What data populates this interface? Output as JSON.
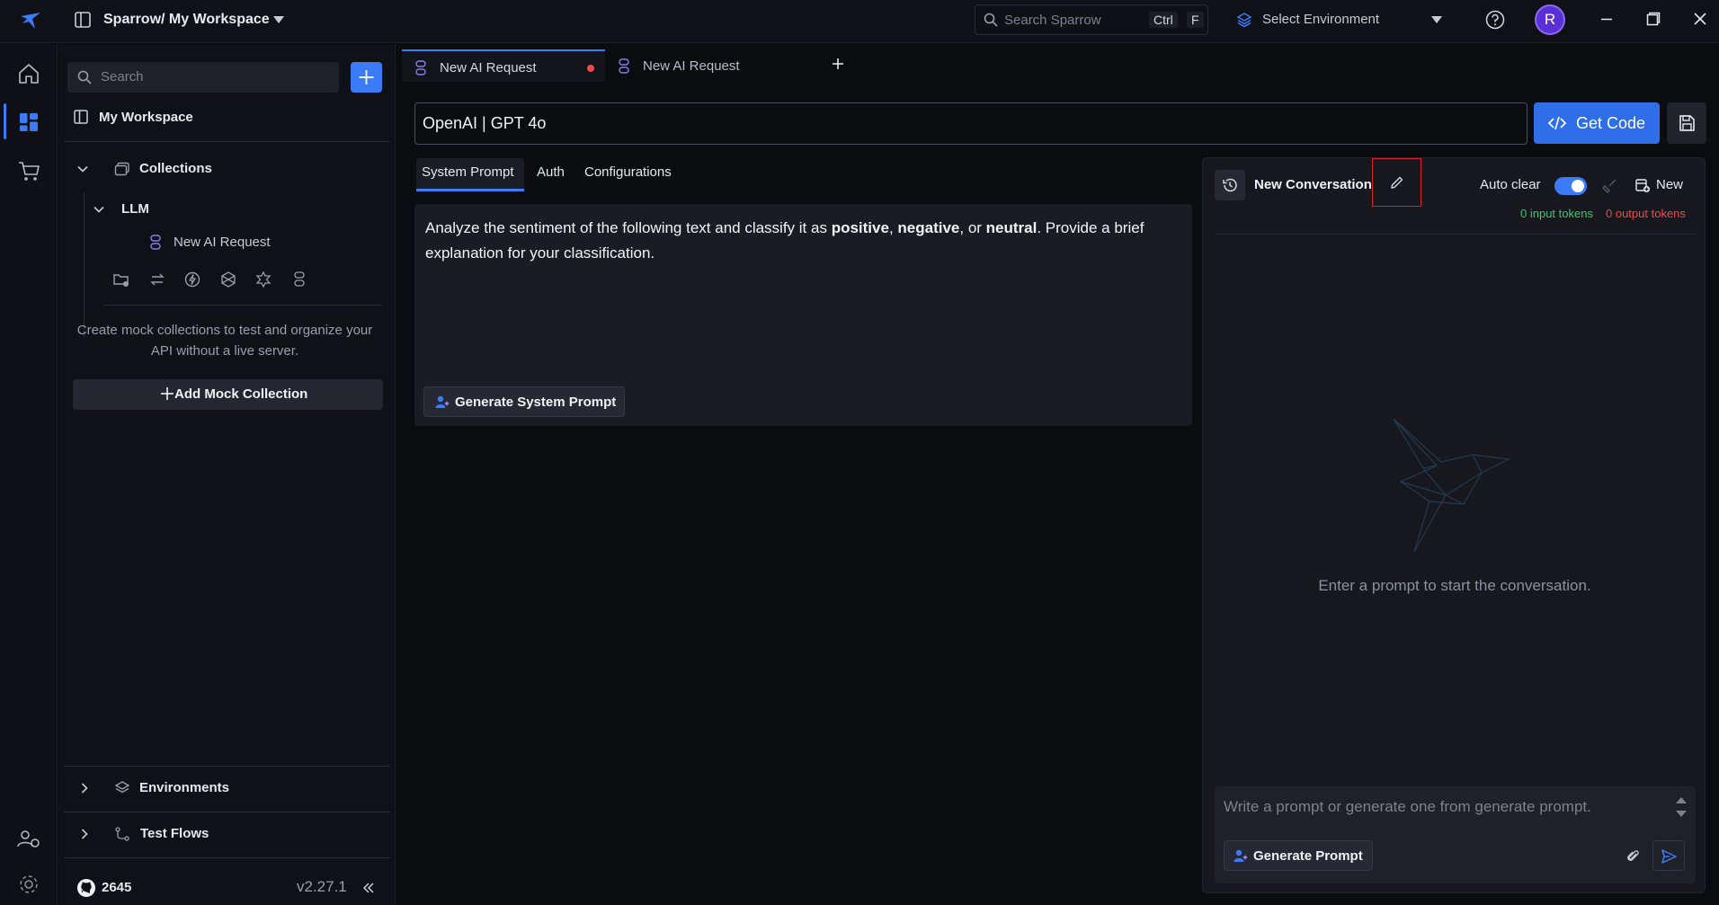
{
  "titlebar": {
    "workspace_title": "Sparrow/ My Workspace",
    "search_placeholder": "Search Sparrow",
    "shortcut_ctrl": "Ctrl",
    "shortcut_key": "F",
    "environment_label": "Select Environment",
    "avatar_initial": "R"
  },
  "sidebar": {
    "search_placeholder": "Search",
    "workspace_name": "My Workspace",
    "collections_label": "Collections",
    "folder_label": "LLM",
    "request_label": "New AI Request",
    "mock_text": "Create mock collections to test and organize your API without a live server.",
    "mock_button_label": "Add Mock Collection",
    "environments_label": "Environments",
    "test_flows_label": "Test Flows",
    "github_stars": "2645",
    "version": "v2.27.1"
  },
  "tabs": [
    {
      "label": "New AI Request",
      "unsaved": true,
      "active": true
    },
    {
      "label": "New AI Request",
      "unsaved": false,
      "active": false
    }
  ],
  "request": {
    "model": "OpenAI | GPT 4o",
    "get_code_label": "Get Code",
    "subtabs": [
      "System Prompt",
      "Auth",
      "Configurations"
    ],
    "prompt_part1": "Analyze the sentiment of the following text and classify it as ",
    "prompt_bold1": "positive",
    "prompt_sep1": ", ",
    "prompt_bold2": "negative",
    "prompt_sep2": ", or ",
    "prompt_bold3": "neutral",
    "prompt_part2": ". Provide a brief explanation for your classification.",
    "generate_system_prompt_label": "Generate System Prompt"
  },
  "chat": {
    "title": "New Conversation",
    "auto_clear_label": "Auto clear",
    "auto_clear_on": true,
    "new_label": "New",
    "input_tokens": "0 input tokens",
    "output_tokens": "0 output tokens",
    "empty_text": "Enter a prompt to start the conversation.",
    "input_placeholder": "Write a prompt or generate one from generate prompt.",
    "generate_prompt_label": "Generate Prompt"
  },
  "colors": {
    "accent": "#3b7bf6",
    "input_tokens": "#3ec46d",
    "output_tokens": "#f0484f",
    "highlight": "#d8202a"
  }
}
